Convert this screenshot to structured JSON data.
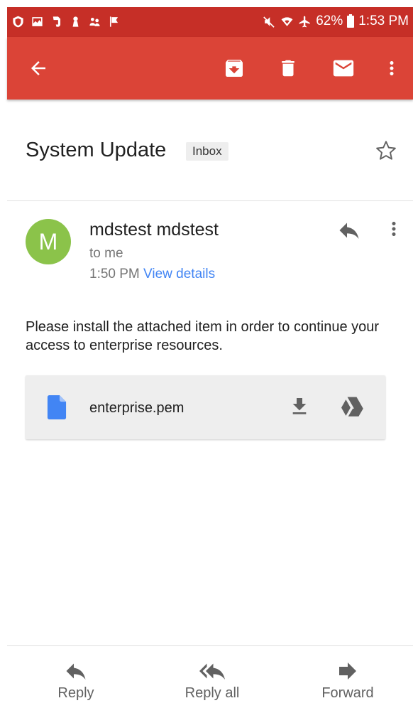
{
  "status_bar": {
    "battery": "62%",
    "time": "1:53 PM"
  },
  "app_bar": {
    "icons": [
      "back-arrow-icon",
      "archive-icon",
      "delete-icon",
      "mark-unread-icon",
      "more-vert-icon"
    ]
  },
  "message": {
    "subject": "System Update",
    "label": "Inbox",
    "avatar_letter": "M",
    "avatar_color": "#8bc34a",
    "sender": "mdstest mdstest",
    "recipient": "to me",
    "time": "1:50 PM",
    "view_details": "View details",
    "body": "Please install the attached item in order to continue your access to enterprise resources."
  },
  "attachment": {
    "file_name": "enterprise.pem",
    "file_icon_color": "#4285f4"
  },
  "bottom_actions": {
    "reply": "Reply",
    "reply_all": "Reply all",
    "forward": "Forward"
  },
  "colors": {
    "app_bar": "#db4437",
    "status_bar": "#c62f27",
    "link": "#4285f4"
  }
}
